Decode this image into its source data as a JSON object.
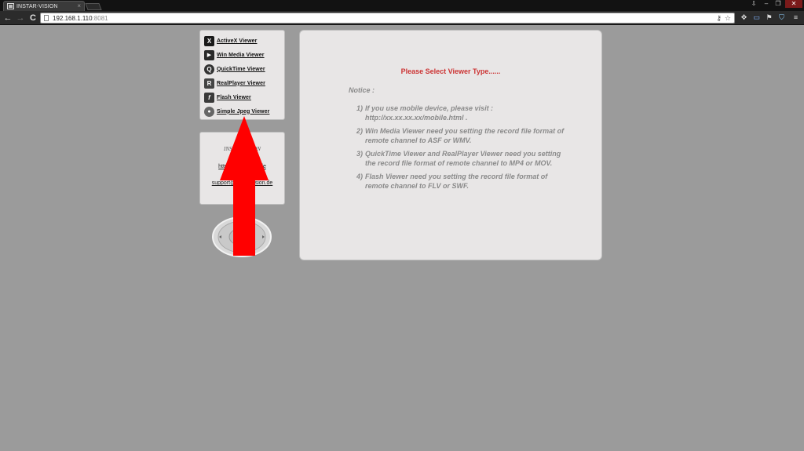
{
  "browser": {
    "tab_title": "INSTAR-VISION",
    "tab_close": "×",
    "url_host": "192.168.1.110",
    "url_port": ":8081",
    "controls": {
      "back": "←",
      "forward": "→",
      "reload": "C"
    },
    "window_buttons": {
      "minimize": "–",
      "restore": "❐",
      "close": "✕",
      "profile": "⇩"
    }
  },
  "viewer_menu": {
    "items": [
      {
        "label": "ActiveX Viewer",
        "icon": "X"
      },
      {
        "label": "Win Media Viewer",
        "icon": "▶"
      },
      {
        "label": "QuickTime Viewer",
        "icon": "Q"
      },
      {
        "label": "RealPlayer Viewer",
        "icon": "R"
      },
      {
        "label": "Flash Viewer",
        "icon": "f"
      },
      {
        "label": "Simple Jpeg Viewer",
        "icon": "●"
      }
    ]
  },
  "info_box": {
    "brand": "INSTAR-VISION",
    "link1": "http://www.instar.de",
    "link2": "support@instar-vision.de"
  },
  "main": {
    "title": "Please Select Viewer Type......",
    "notice_label": "Notice :",
    "notices": [
      {
        "num": "1)",
        "text": "If you use mobile device, please visit : http://xx.xx.xx.xx/mobile.html ."
      },
      {
        "num": "2)",
        "text": "Win Media Viewer need you setting the record file format of remote channel to ASF or WMV."
      },
      {
        "num": "3)",
        "text": "QuickTime Viewer and RealPlayer Viewer need you setting the record file format of remote channel to MP4 or MOV."
      },
      {
        "num": "4)",
        "text": "Flash Viewer need you setting the record file format of remote channel to FLV or SWF."
      }
    ]
  },
  "colors": {
    "page_bg": "#9b9b9b",
    "panel_bg": "#e8e6e6",
    "title_red": "#cc3333",
    "notice_gray": "#8a8a8a",
    "annotation_arrow": "#ff0000"
  }
}
